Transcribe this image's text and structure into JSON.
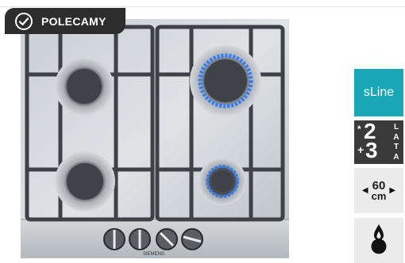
{
  "badge": {
    "label": "POLECAMY",
    "icon": "check-circle-icon"
  },
  "product": {
    "brand_label": "SIEMENS"
  },
  "features": {
    "series": "sLine",
    "warranty": {
      "star": "*",
      "base": "2",
      "plus": "+",
      "extra": "3",
      "letters": [
        "L",
        "A",
        "T",
        "A"
      ]
    },
    "width": {
      "value": "60",
      "unit": "cm",
      "left_icon": "arrow-left-icon",
      "right_icon": "arrow-right-icon"
    },
    "gas_icon": "gas-flame-icon"
  },
  "colors": {
    "badge_bg": "#2d2d2d",
    "sline_bg": "#1aa8b8",
    "warranty_bg": "#3a3a3a",
    "tile_bg": "#ebebeb"
  }
}
